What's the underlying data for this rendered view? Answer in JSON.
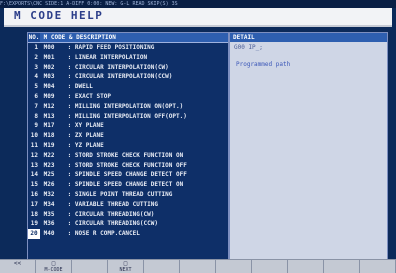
{
  "top_strip": "F:\\EXPORTS\\CNC   SIDE:1 A-DIFF   0:00:  NEW:  G-L   READ SKIP(S)   3S",
  "title": "M CODE HELP",
  "list": {
    "header_no": "NO.",
    "header_desc": "M CODE & DESCRIPTION",
    "rows": [
      {
        "num": "1",
        "code": "M00",
        "desc": "RAPID FEED POSITIONING"
      },
      {
        "num": "2",
        "code": "M01",
        "desc": "LINEAR INTERPOLATION"
      },
      {
        "num": "3",
        "code": "M02",
        "desc": "CIRCULAR INTERPOLATION(CW)"
      },
      {
        "num": "4",
        "code": "M03",
        "desc": "CIRCULAR INTERPOLATION(CCW)"
      },
      {
        "num": "5",
        "code": "M04",
        "desc": "DWELL"
      },
      {
        "num": "6",
        "code": "M09",
        "desc": "EXACT STOP"
      },
      {
        "num": "7",
        "code": "M12",
        "desc": "MILLING INTERPOLATION ON(OPT.)"
      },
      {
        "num": "8",
        "code": "M13",
        "desc": "MILLING INTERPOLATION OFF(OPT.)"
      },
      {
        "num": "9",
        "code": "M17",
        "desc": "XY PLANE"
      },
      {
        "num": "10",
        "code": "M18",
        "desc": "ZX PLANE"
      },
      {
        "num": "11",
        "code": "M19",
        "desc": "YZ PLANE"
      },
      {
        "num": "12",
        "code": "M22",
        "desc": "STORD STROKE CHECK FUNCTION ON"
      },
      {
        "num": "13",
        "code": "M23",
        "desc": "STORD STROKE CHECK FUNCTION OFF"
      },
      {
        "num": "14",
        "code": "M25",
        "desc": "SPINDLE SPEED CHANGE DETECT OFF"
      },
      {
        "num": "15",
        "code": "M26",
        "desc": "SPINDLE SPEED CHANGE DETECT ON"
      },
      {
        "num": "16",
        "code": "M32",
        "desc": "SINGLE POINT THREAD CUTTING"
      },
      {
        "num": "17",
        "code": "M34",
        "desc": "VARIABLE THREAD CUTTING"
      },
      {
        "num": "18",
        "code": "M35",
        "desc": "CIRCULAR THREADING(CW)"
      },
      {
        "num": "19",
        "code": "M36",
        "desc": "CIRCULAR THREADING(CCW)"
      },
      {
        "num": "20",
        "code": "M40",
        "desc": "NOSE R COMP.CANCEL"
      }
    ]
  },
  "detail": {
    "header": "DETAIL",
    "line1": "G00 IP_;",
    "line2": "Programmed path"
  },
  "fkeys": [
    {
      "icon": "<<",
      "label": ""
    },
    {
      "icon": "□",
      "label": "M-CODE"
    },
    {
      "icon": "",
      "label": ""
    },
    {
      "icon": "□",
      "label": "NEXT"
    },
    {
      "icon": "",
      "label": ""
    },
    {
      "icon": "",
      "label": ""
    },
    {
      "icon": "",
      "label": ""
    },
    {
      "icon": "",
      "label": ""
    },
    {
      "icon": "",
      "label": ""
    },
    {
      "icon": "",
      "label": ""
    },
    {
      "icon": "",
      "label": ""
    }
  ]
}
